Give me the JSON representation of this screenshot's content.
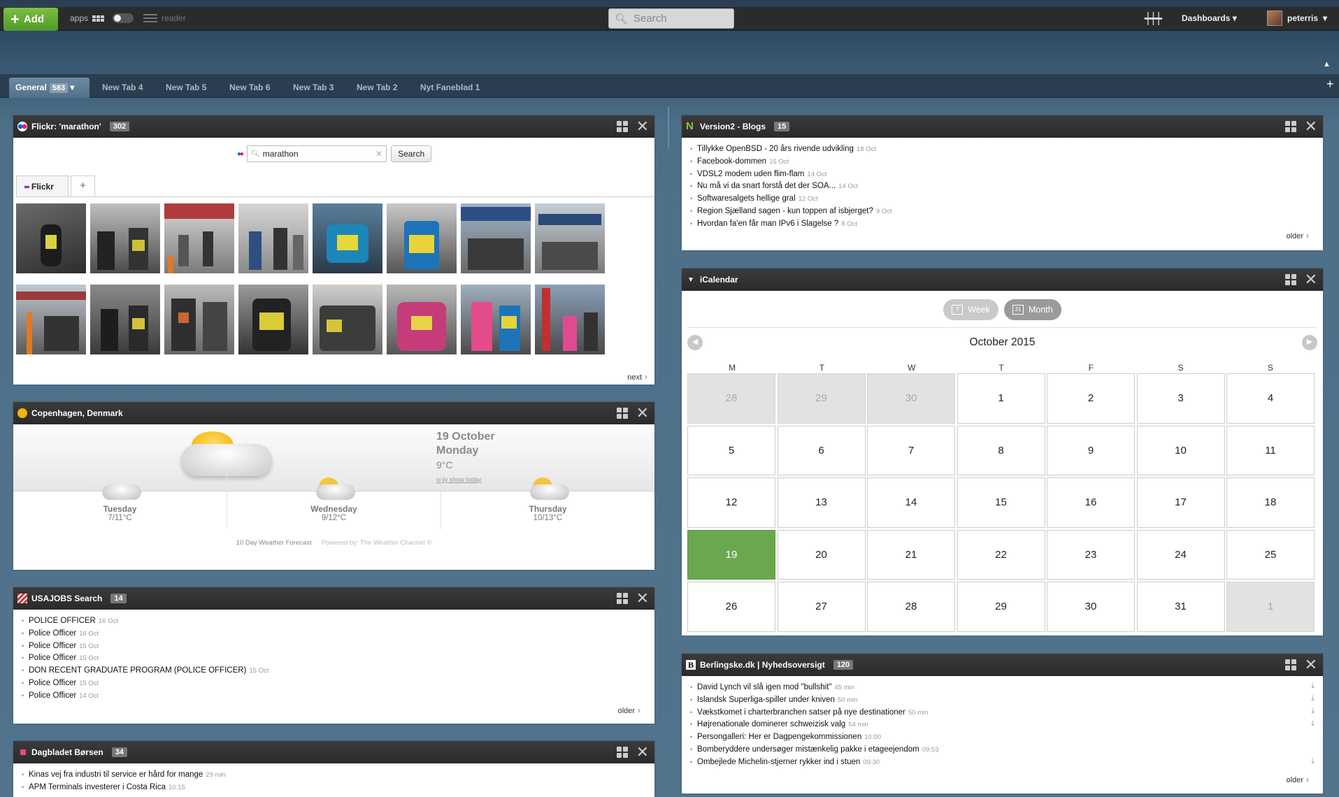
{
  "topbar": {
    "add_label": "Add",
    "apps_label": "apps",
    "reader_label": "reader",
    "search_placeholder": "Search",
    "dashboards_label": "Dashboards",
    "username": "peterris"
  },
  "tabs": {
    "active": {
      "label": "General",
      "count": "583"
    },
    "others": [
      "New Tab 4",
      "New Tab 5",
      "New Tab 6",
      "New Tab 3",
      "New Tab 2",
      "Nyt Faneblad 1"
    ]
  },
  "flickr": {
    "title": "Flickr: 'marathon'",
    "count": "302",
    "query": "marathon",
    "search_button": "Search",
    "tab_label": "Flickr",
    "next_label": "next"
  },
  "weather": {
    "title": "Copenhagen, Denmark",
    "date": "19 October",
    "day": "Monday",
    "temp": "9°C",
    "only_today": "only show today",
    "forecast": [
      {
        "day": "Tuesday",
        "temps": "7/11°C",
        "icon": "cloudy-icon"
      },
      {
        "day": "Wednesday",
        "temps": "9/12°C",
        "icon": "partly-cloudy-icon"
      },
      {
        "day": "Thursday",
        "temps": "10/13°C",
        "icon": "partly-cloudy-icon"
      }
    ],
    "footer_link": "10 Day Weather Forecast",
    "powered_by": "Powered by: The Weather Channel ®"
  },
  "usajobs": {
    "title": "USAJOBS Search",
    "count": "14",
    "items": [
      {
        "text": "POLICE OFFICER",
        "time": "16 Oct"
      },
      {
        "text": "Police Officer",
        "time": "16 Oct"
      },
      {
        "text": "Police Officer",
        "time": "15 Oct"
      },
      {
        "text": "Police Officer",
        "time": "15 Oct"
      },
      {
        "text": "DON RECENT GRADUATE PROGRAM (POLICE OFFICER)",
        "time": "15 Oct"
      },
      {
        "text": "Police Officer",
        "time": "15 Oct"
      },
      {
        "text": "Police Officer",
        "time": "14 Oct"
      }
    ],
    "older_label": "older"
  },
  "borsen": {
    "title": "Dagbladet Børsen",
    "count": "34",
    "items": [
      {
        "text": "Kinas vej fra industri til service er hård for mange",
        "time": "29 min"
      },
      {
        "text": "APM Terminals investerer i Costa Rica",
        "time": "10:15"
      }
    ]
  },
  "version2": {
    "title": "Version2 - Blogs",
    "count": "15",
    "items": [
      {
        "text": "Tillykke OpenBSD - 20 års rivende udvikling",
        "time": "18 Oct"
      },
      {
        "text": "Facebook-dommen",
        "time": "15 Oct"
      },
      {
        "text": "VDSL2 modem uden flim-flam",
        "time": "14 Oct"
      },
      {
        "text": "Nu må vi da snart forstå det der SOA...",
        "time": "14 Oct"
      },
      {
        "text": "Softwaresalgets hellige gral",
        "time": "12 Oct"
      },
      {
        "text": "Region Sjælland sagen - kun toppen af isbjerget?",
        "time": "9 Oct"
      },
      {
        "text": "Hvordan fa'en får man IPv6 i Slagelse ?",
        "time": "8 Oct"
      }
    ],
    "older_label": "older"
  },
  "calendar": {
    "title": "iCalendar",
    "week_label": "Week",
    "week_icon_text": "7",
    "month_label": "Month",
    "month_icon_text": "31",
    "month_title": "October 2015",
    "dow": [
      "M",
      "T",
      "W",
      "T",
      "F",
      "S",
      "S"
    ],
    "cells": [
      {
        "d": "28",
        "k": "other"
      },
      {
        "d": "29",
        "k": "other"
      },
      {
        "d": "30",
        "k": "other"
      },
      {
        "d": "1",
        "k": ""
      },
      {
        "d": "2",
        "k": ""
      },
      {
        "d": "3",
        "k": ""
      },
      {
        "d": "4",
        "k": ""
      },
      {
        "d": "5",
        "k": ""
      },
      {
        "d": "6",
        "k": ""
      },
      {
        "d": "7",
        "k": ""
      },
      {
        "d": "8",
        "k": ""
      },
      {
        "d": "9",
        "k": ""
      },
      {
        "d": "10",
        "k": ""
      },
      {
        "d": "11",
        "k": ""
      },
      {
        "d": "12",
        "k": ""
      },
      {
        "d": "13",
        "k": ""
      },
      {
        "d": "14",
        "k": ""
      },
      {
        "d": "15",
        "k": ""
      },
      {
        "d": "16",
        "k": ""
      },
      {
        "d": "17",
        "k": ""
      },
      {
        "d": "18",
        "k": ""
      },
      {
        "d": "19",
        "k": "today"
      },
      {
        "d": "20",
        "k": ""
      },
      {
        "d": "21",
        "k": ""
      },
      {
        "d": "22",
        "k": ""
      },
      {
        "d": "23",
        "k": ""
      },
      {
        "d": "24",
        "k": ""
      },
      {
        "d": "25",
        "k": ""
      },
      {
        "d": "26",
        "k": ""
      },
      {
        "d": "27",
        "k": ""
      },
      {
        "d": "28",
        "k": ""
      },
      {
        "d": "29",
        "k": ""
      },
      {
        "d": "30",
        "k": ""
      },
      {
        "d": "31",
        "k": ""
      },
      {
        "d": "1",
        "k": "other"
      }
    ],
    "today_color": "#6aa84f"
  },
  "berlingske": {
    "title": "Berlingske.dk | Nyhedsoversigt",
    "count": "120",
    "items": [
      {
        "text": "David Lynch vil slå igen mod \"bullshit\"",
        "time": "45 min"
      },
      {
        "text": "Islandsk Superliga-spiller under kniven",
        "time": "50 min"
      },
      {
        "text": "Vækstkomet i charterbranchen satser på nye destinationer",
        "time": "50 min"
      },
      {
        "text": "Højrenationale dominerer schweizisk valg",
        "time": "54 min"
      },
      {
        "text": "Persongalleri: Her er Dagpengekommissionen",
        "time": "10:00"
      },
      {
        "text": "Bomberyddere undersøger mistænkelig pakke i etageejendom",
        "time": "09:53"
      },
      {
        "text": "Ombejlede Michelin-stjerner rykker ind i stuen",
        "time": "09:30"
      }
    ],
    "older_label": "older"
  }
}
